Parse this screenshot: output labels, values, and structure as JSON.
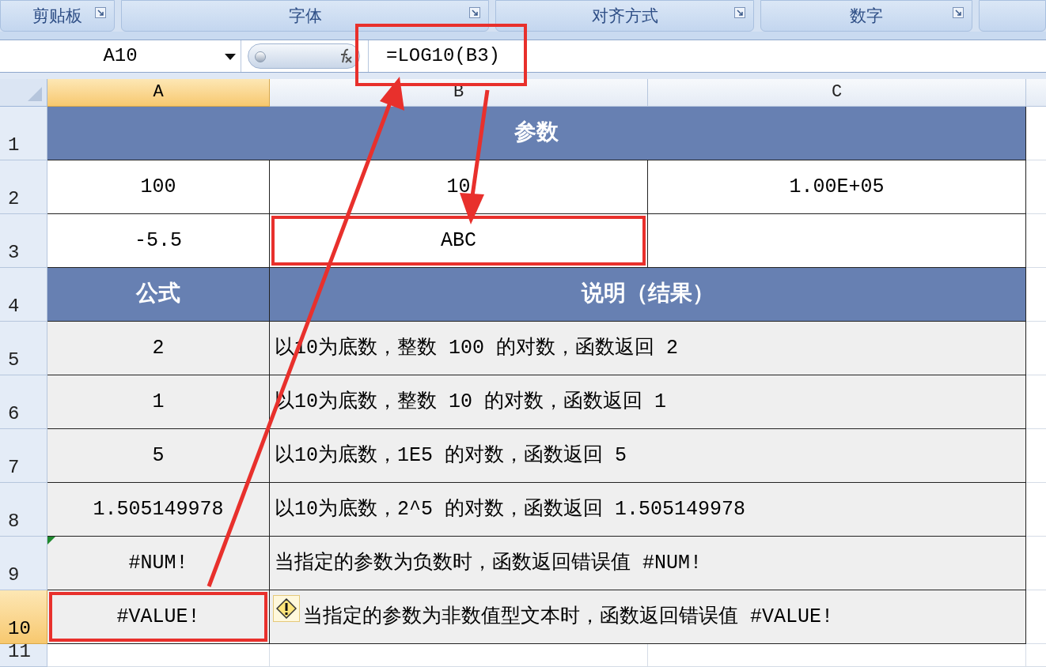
{
  "ribbon_groups": [
    {
      "label": "剪贴板"
    },
    {
      "label": "字体"
    },
    {
      "label": "对齐方式"
    },
    {
      "label": "数字"
    }
  ],
  "formula_bar": {
    "name_box": "A10",
    "formula": "=LOG10(B3)",
    "highlighted": true
  },
  "columns": [
    {
      "label": "A",
      "selected": true
    },
    {
      "label": "B",
      "selected": false
    },
    {
      "label": "C",
      "selected": false
    }
  ],
  "rows": [
    {
      "number": "1",
      "selected": false,
      "cells": [
        {
          "text": "参数",
          "kind": "header",
          "merged": true
        }
      ]
    },
    {
      "number": "2",
      "selected": false,
      "cells": [
        {
          "text": "100",
          "kind": "param"
        },
        {
          "text": "10",
          "kind": "param"
        },
        {
          "text": "1.00E+05",
          "kind": "param"
        }
      ]
    },
    {
      "number": "3",
      "selected": false,
      "cells": [
        {
          "text": "-5.5",
          "kind": "param"
        },
        {
          "text": "ABC",
          "kind": "param",
          "highlighted": true
        },
        {
          "kind": "param"
        }
      ]
    },
    {
      "number": "4",
      "selected": false,
      "cells": [
        {
          "text": "公式",
          "kind": "header"
        },
        {
          "text": "说明（结果）",
          "kind": "header",
          "merged": true
        }
      ]
    },
    {
      "number": "5",
      "selected": false,
      "cells": [
        {
          "text": "2",
          "kind": "result"
        },
        {
          "text": "以10为底数，整数 100 的对数，函数返回 2",
          "kind": "description",
          "merged": true
        }
      ]
    },
    {
      "number": "6",
      "selected": false,
      "cells": [
        {
          "text": "1",
          "kind": "result"
        },
        {
          "text": "以10为底数，整数 10 的对数，函数返回 1",
          "kind": "description",
          "merged": true
        }
      ]
    },
    {
      "number": "7",
      "selected": false,
      "cells": [
        {
          "text": "5",
          "kind": "result"
        },
        {
          "text": "以10为底数，1E5 的对数，函数返回 5",
          "kind": "description",
          "merged": true
        }
      ]
    },
    {
      "number": "8",
      "selected": false,
      "cells": [
        {
          "text": "1.505149978",
          "kind": "result"
        },
        {
          "text": "以10为底数，2^5 的对数，函数返回 1.505149978",
          "kind": "description",
          "merged": true
        }
      ]
    },
    {
      "number": "9",
      "selected": false,
      "cells": [
        {
          "text": "#NUM!",
          "kind": "result",
          "flagged": true
        },
        {
          "text": "当指定的参数为负数时，函数返回错误值 #NUM!",
          "kind": "description",
          "merged": true
        }
      ]
    },
    {
      "number": "10",
      "selected": true,
      "cells": [
        {
          "text": "#VALUE!",
          "kind": "result",
          "highlighted": true
        },
        {
          "text": "当指定的参数为非数值型文本时，函数返回错误值 #VALUE!",
          "kind": "description",
          "merged": true,
          "warning": true
        }
      ]
    },
    {
      "number": "11",
      "selected": false
    }
  ]
}
